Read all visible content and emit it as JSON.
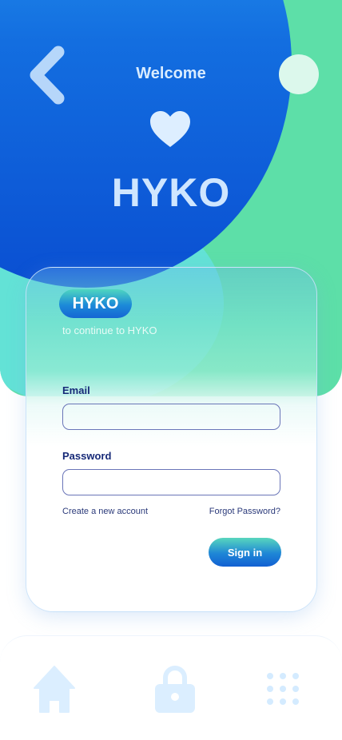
{
  "header": {
    "welcome": "Welcome",
    "brand": "HYKO",
    "back_icon": "chevron-left-icon",
    "heart_icon": "heart-icon"
  },
  "card": {
    "badge": "HYKO",
    "subtitle": "to continue to HYKO",
    "email_label": "Email",
    "email_value": "",
    "password_label": "Password",
    "password_value": "",
    "create_account": "Create a new account",
    "forgot_password": "Forgot Password?",
    "sign_in": "Sign in"
  },
  "bottom_nav": {
    "items": [
      {
        "icon": "home-icon"
      },
      {
        "icon": "lock-icon"
      },
      {
        "icon": "grid-dots-icon"
      }
    ]
  },
  "colors": {
    "primary_blue": "#136ee0",
    "accent_green": "#5ddfa8",
    "label_navy": "#172a78",
    "icon_light": "#dbeeff"
  }
}
